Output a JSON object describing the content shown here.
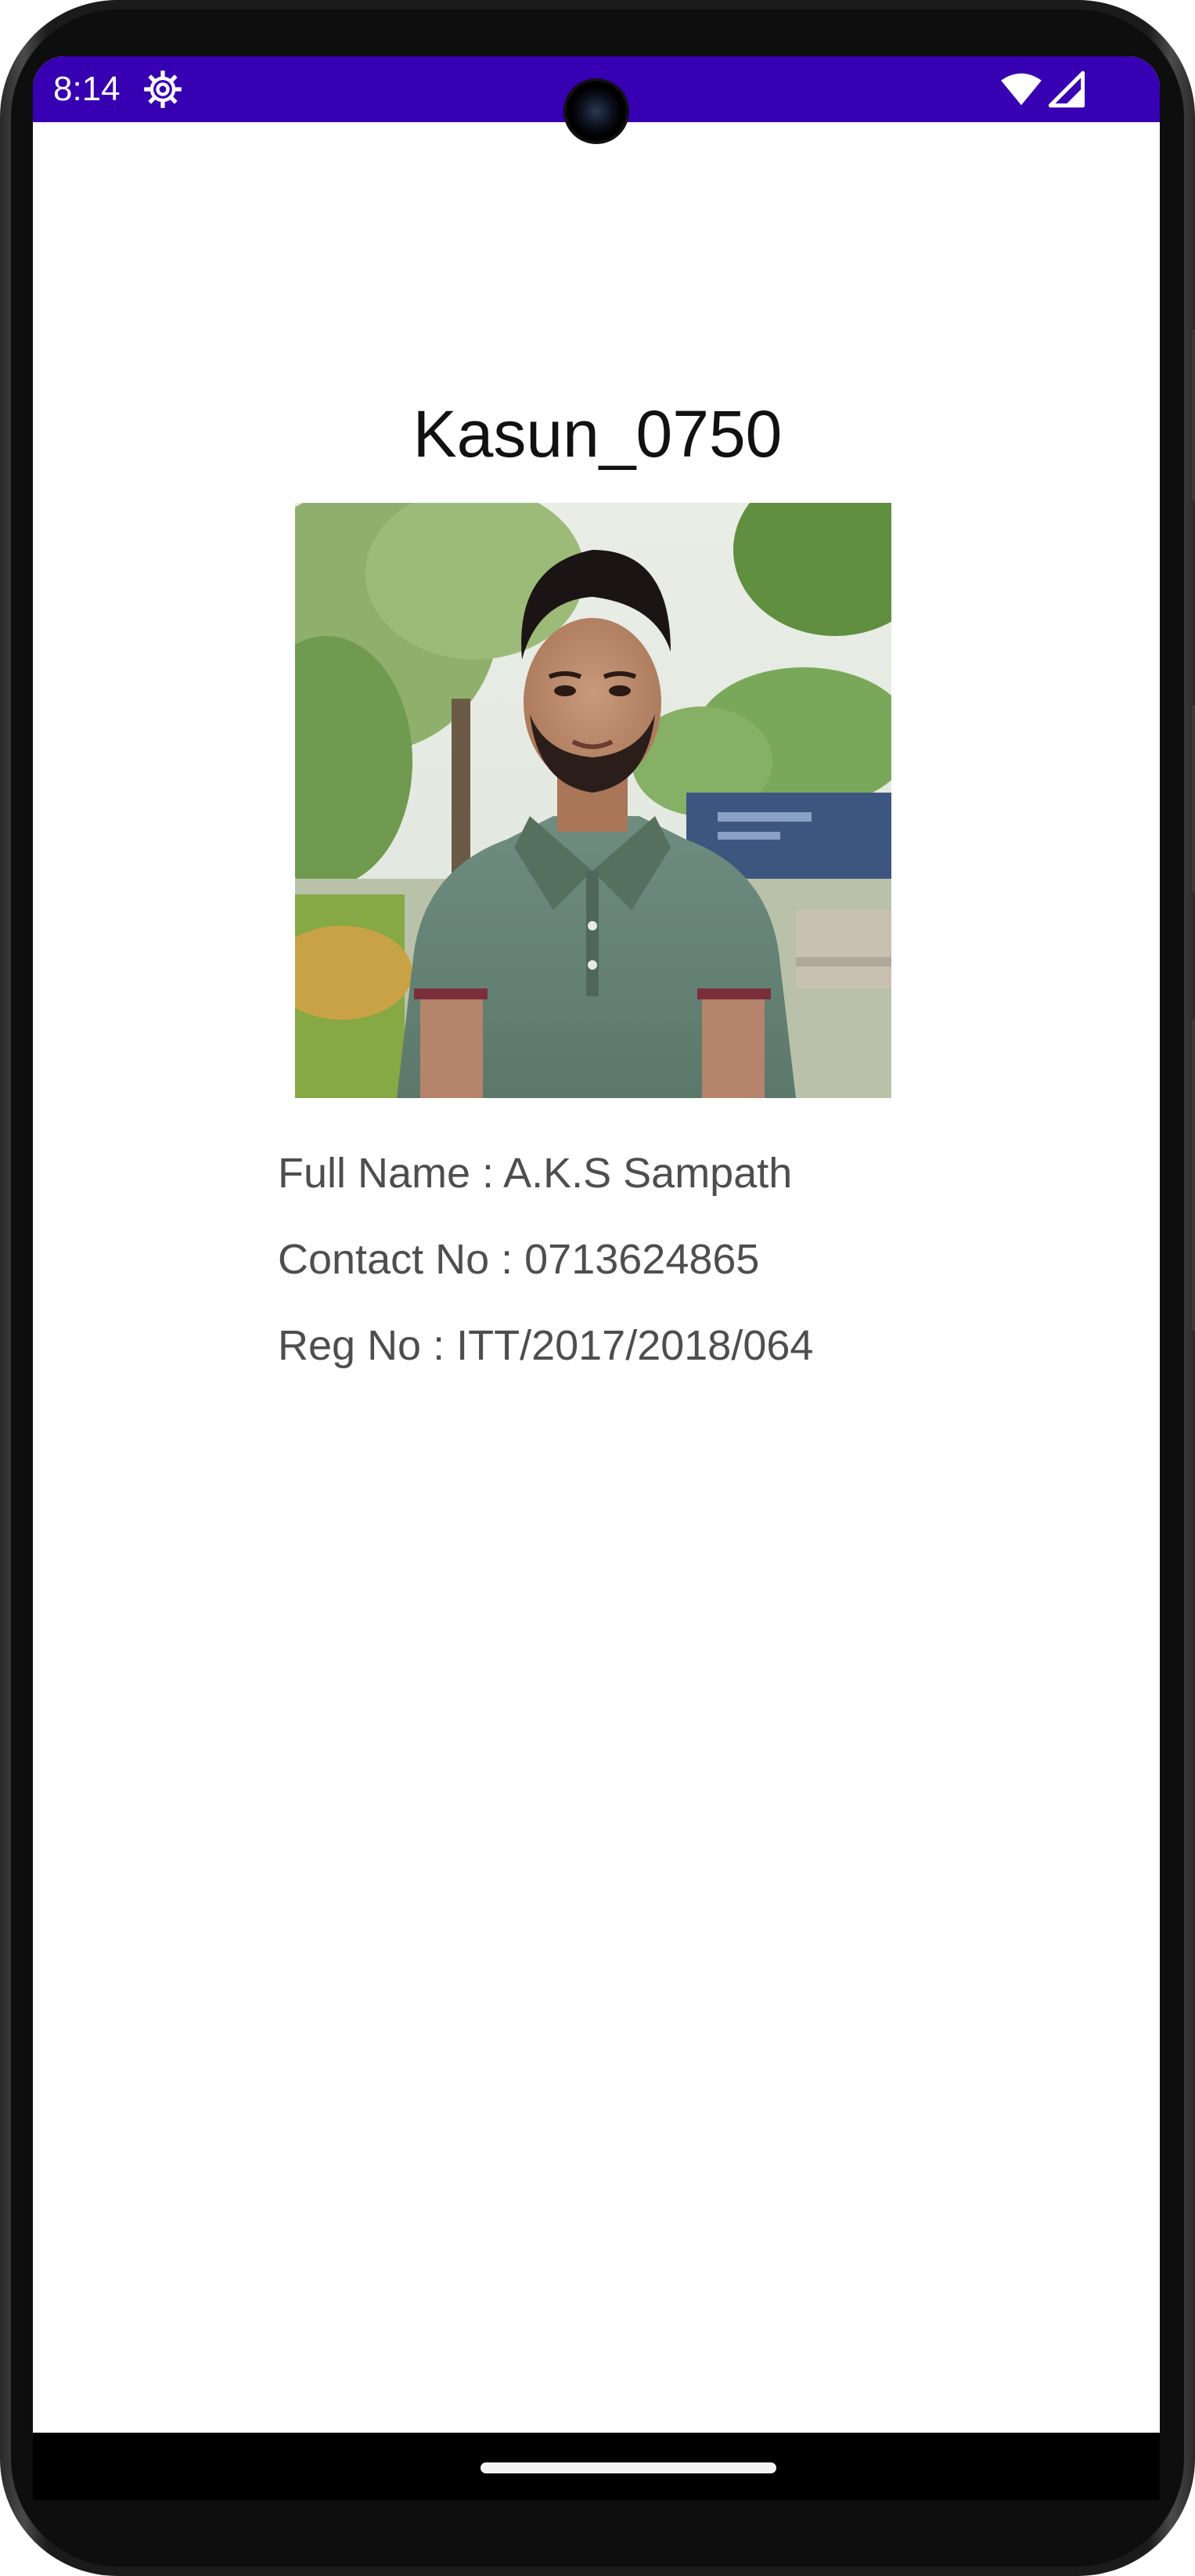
{
  "status_bar": {
    "time": "8:14",
    "background_color": "#3700b3",
    "icons": [
      "settings-gear-icon",
      "wifi-icon",
      "cell-signal-icon"
    ]
  },
  "profile": {
    "username": "Kasun_0750",
    "photo_icon": "profile-photo",
    "full_name_line": "Full Name : A.K.S Sampath",
    "contact_line": "Contact No : 0713624865",
    "reg_line": "Reg No : ITT/2017/2018/064"
  },
  "navigation": {
    "home_indicator": "home-gesture-bar"
  }
}
